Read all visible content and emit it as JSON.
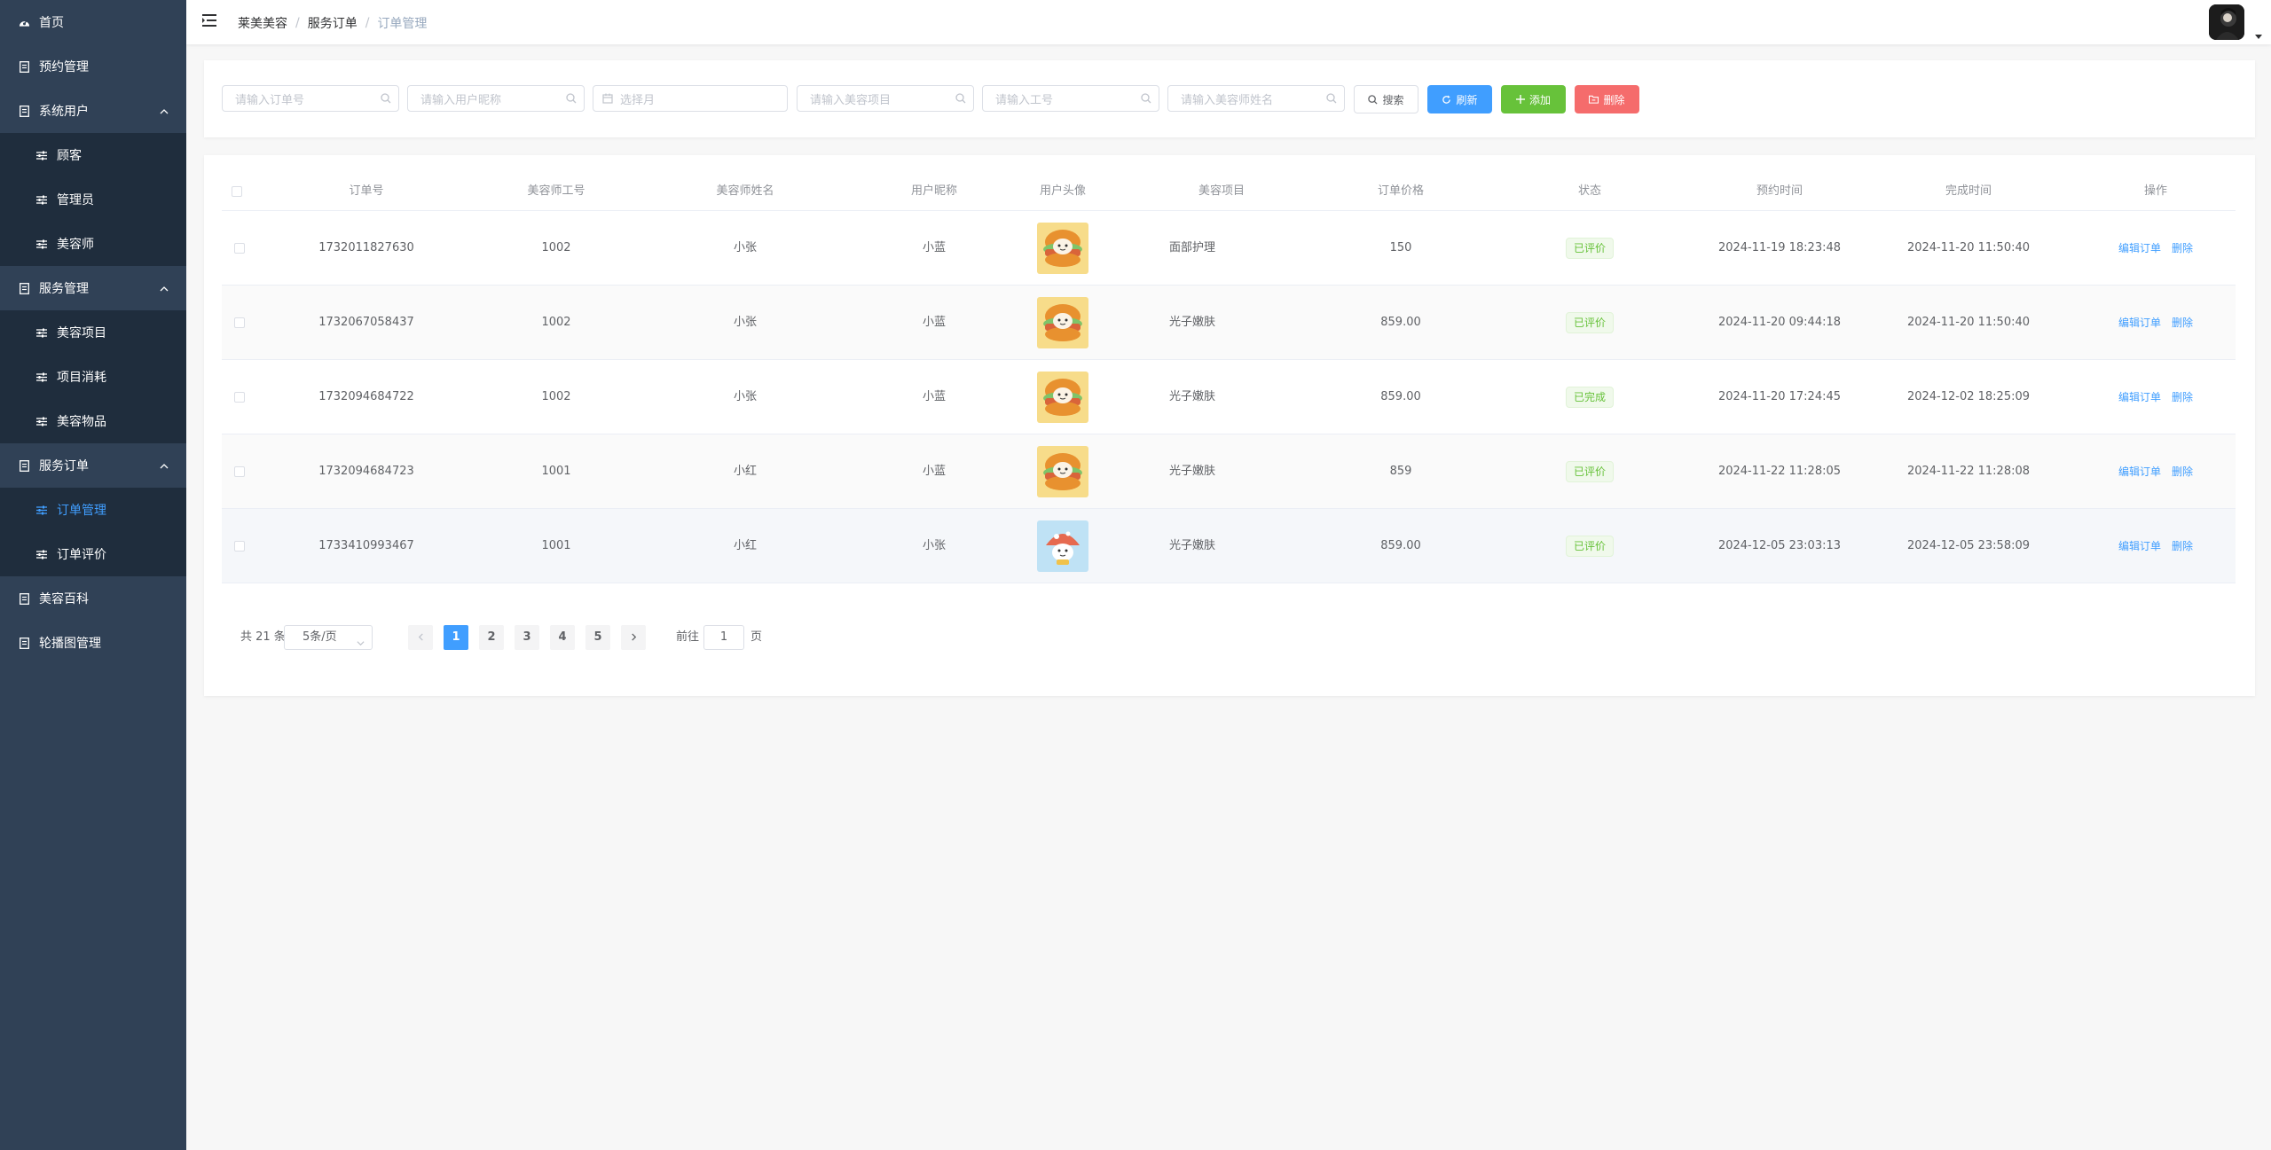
{
  "sidebar": {
    "items": [
      {
        "label": "首页",
        "icon": "dashboard-icon",
        "level": "top"
      },
      {
        "label": "预约管理",
        "icon": "document-icon",
        "level": "top"
      },
      {
        "label": "系统用户",
        "icon": "document-icon",
        "level": "top",
        "expanded": true
      },
      {
        "label": "顾客",
        "icon": "sliders-icon",
        "level": "sub"
      },
      {
        "label": "管理员",
        "icon": "sliders-icon",
        "level": "sub"
      },
      {
        "label": "美容师",
        "icon": "sliders-icon",
        "level": "sub"
      },
      {
        "label": "服务管理",
        "icon": "document-icon",
        "level": "top",
        "expanded": true
      },
      {
        "label": "美容项目",
        "icon": "sliders-icon",
        "level": "sub"
      },
      {
        "label": "项目消耗",
        "icon": "sliders-icon",
        "level": "sub"
      },
      {
        "label": "美容物品",
        "icon": "sliders-icon",
        "level": "sub"
      },
      {
        "label": "服务订单",
        "icon": "document-icon",
        "level": "top",
        "expanded": true
      },
      {
        "label": "订单管理",
        "icon": "sliders-icon",
        "level": "sub",
        "active": true
      },
      {
        "label": "订单评价",
        "icon": "sliders-icon",
        "level": "sub"
      },
      {
        "label": "美容百科",
        "icon": "document-icon",
        "level": "top"
      },
      {
        "label": "轮播图管理",
        "icon": "document-icon",
        "level": "top"
      }
    ]
  },
  "header": {
    "breadcrumb": [
      "莱美美容",
      "服务订单",
      "订单管理"
    ]
  },
  "search": {
    "order_no_placeholder": "请输入订单号",
    "nickname_placeholder": "请输入用户昵称",
    "month_placeholder": "选择月",
    "project_placeholder": "请输入美容项目",
    "job_no_placeholder": "请输入工号",
    "beautician_placeholder": "请输入美容师姓名",
    "search_label": "搜索",
    "refresh_label": "刷新",
    "add_label": "添加",
    "delete_label": "删除"
  },
  "table": {
    "columns": [
      "订单号",
      "美容师工号",
      "美容师姓名",
      "用户昵称",
      "用户头像",
      "美容项目",
      "订单价格",
      "状态",
      "预约时间",
      "完成时间",
      "操作"
    ],
    "rows": [
      {
        "order_no": "1732011827630",
        "job_no": "1002",
        "beautician": "小张",
        "nickname": "小蓝",
        "avatar": "burger",
        "project": "面部护理",
        "price": "150",
        "status": "已评价",
        "appointment": "2024-11-19 18:23:48",
        "finished": "2024-11-20 11:50:40"
      },
      {
        "order_no": "1732067058437",
        "job_no": "1002",
        "beautician": "小张",
        "nickname": "小蓝",
        "avatar": "burger",
        "project": "光子嫩肤",
        "price": "859.00",
        "status": "已评价",
        "appointment": "2024-11-20 09:44:18",
        "finished": "2024-11-20 11:50:40"
      },
      {
        "order_no": "1732094684722",
        "job_no": "1002",
        "beautician": "小张",
        "nickname": "小蓝",
        "avatar": "burger",
        "project": "光子嫩肤",
        "price": "859.00",
        "status": "已完成",
        "appointment": "2024-11-20 17:24:45",
        "finished": "2024-12-02 18:25:09"
      },
      {
        "order_no": "1732094684723",
        "job_no": "1001",
        "beautician": "小红",
        "nickname": "小蓝",
        "avatar": "burger",
        "project": "光子嫩肤",
        "price": "859",
        "status": "已评价",
        "appointment": "2024-11-22 11:28:05",
        "finished": "2024-11-22 11:28:08"
      },
      {
        "order_no": "1733410993467",
        "job_no": "1001",
        "beautician": "小红",
        "nickname": "小张",
        "avatar": "mushroom",
        "project": "光子嫩肤",
        "price": "859.00",
        "status": "已评价",
        "appointment": "2024-12-05 23:03:13",
        "finished": "2024-12-05 23:58:09"
      }
    ],
    "edit_label": "编辑订单",
    "delete_label": "删除"
  },
  "pagination": {
    "total_text": "共 21 条",
    "page_size": "5条/页",
    "pages": [
      "1",
      "2",
      "3",
      "4",
      "5"
    ],
    "current": "1",
    "goto_prefix": "前往",
    "goto_value": "1",
    "goto_suffix": "页"
  },
  "colors": {
    "sidebar_bg": "#304156",
    "submenu_bg": "#1f2d3d",
    "primary": "#409eff",
    "success": "#67c23a",
    "danger": "#f56c6c"
  }
}
